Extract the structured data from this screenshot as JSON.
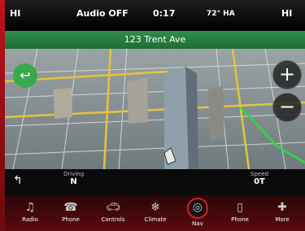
{
  "status": {
    "left_label": "HI",
    "audio": "Audio OFF",
    "time": "0:17",
    "temp": "72° HA",
    "right_label": "HI"
  },
  "street": "123 Trent Ave",
  "info": {
    "left_label": "Driving",
    "left_value": "N",
    "right_label": "Speed",
    "right_value": "0T"
  },
  "menu": [
    {
      "label": "Radio",
      "icon": "radio-icon"
    },
    {
      "label": "Phone",
      "icon": "phone-icon"
    },
    {
      "label": "Controls",
      "icon": "car-icon"
    },
    {
      "label": "Climate",
      "icon": "climate-icon"
    },
    {
      "label": "Nav",
      "icon": "nav-icon"
    },
    {
      "label": "Phone",
      "icon": "phone2-icon"
    },
    {
      "label": "More",
      "icon": "more-icon"
    }
  ],
  "zoom": {
    "in": "+",
    "out": "−"
  }
}
